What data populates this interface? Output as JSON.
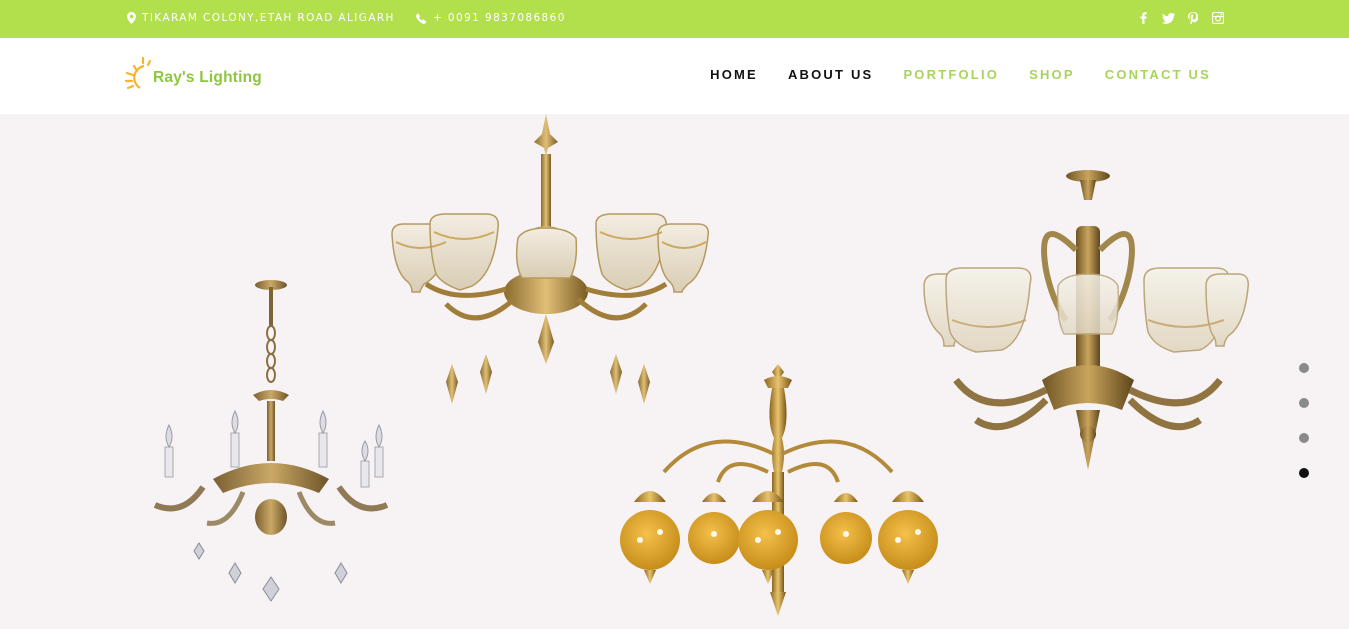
{
  "topbar": {
    "address": "TIKARAM COLONY,ETAH ROAD ALIGARH",
    "phone": "+ 0091 9837086860",
    "socials": [
      "facebook-icon",
      "twitter-icon",
      "pinterest-icon",
      "instagram-icon"
    ],
    "bg_color": "#b2df4c"
  },
  "header": {
    "logo_text": "Ray's Lighting",
    "nav": [
      {
        "label": "HOME"
      },
      {
        "label": "ABOUT US"
      },
      {
        "label": "PORTFOLIO"
      },
      {
        "label": "SHOP"
      },
      {
        "label": "CONTACT US"
      }
    ]
  },
  "slider": {
    "dot_count": 4,
    "active_dot": 4
  },
  "colors": {
    "accent_green": "#a9d45a",
    "brass": "#b8923a",
    "amber_glass": "#d9a21f"
  }
}
